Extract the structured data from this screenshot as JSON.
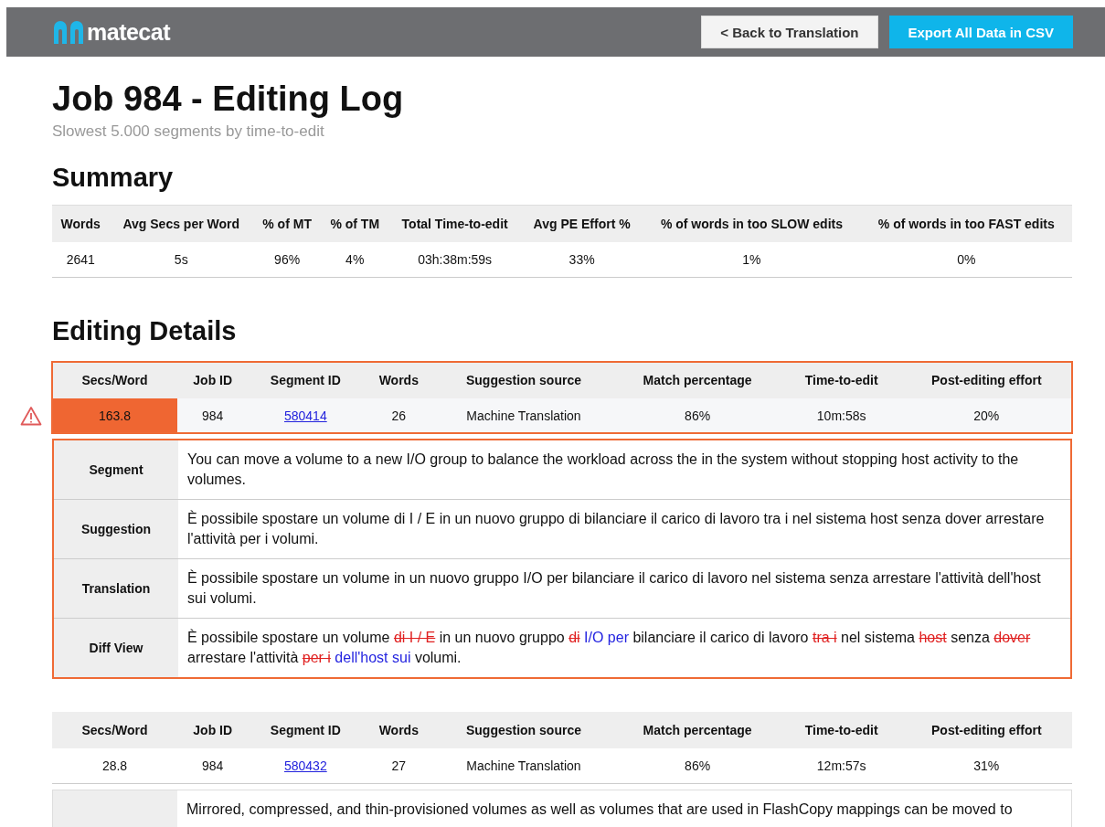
{
  "header": {
    "logo": "matecat",
    "buttons": [
      {
        "label": "< Back to Translation",
        "kind": "secondary"
      },
      {
        "label": "Export All Data in CSV",
        "kind": "primary"
      }
    ]
  },
  "title": "Job 984 - Editing Log",
  "subtitle": "Slowest 5.000 segments by time-to-edit",
  "summary": {
    "heading": "Summary",
    "columns": [
      "Words",
      "Avg Secs per Word",
      "% of MT",
      "% of TM",
      "Total Time-to-edit",
      "Avg PE Effort %",
      "% of words in too SLOW edits",
      "% of words in too FAST edits"
    ],
    "row": [
      "2641",
      "5s",
      "96%",
      "4%",
      "03h:38m:59s",
      "33%",
      "1%",
      "0%"
    ]
  },
  "details": {
    "heading": "Editing Details",
    "entries": [
      {
        "flagged": true,
        "columns": [
          "Secs/Word",
          "Job ID",
          "Segment ID",
          "Words",
          "Suggestion source",
          "Match percentage",
          "Time-to-edit",
          "Post-editing effort"
        ],
        "row": [
          "163.8",
          "984",
          "580414",
          "26",
          "Machine Translation",
          "86%",
          "10m:58s",
          "20%"
        ],
        "sections": [
          {
            "label": "Segment",
            "kind": "text",
            "text": "You can move a volume to a new I/O group to balance the workload across the in the system without stopping host activity to the volumes."
          },
          {
            "label": "Suggestion",
            "kind": "text",
            "text": "È possibile spostare un volume di I / E in un nuovo gruppo di bilanciare il carico di lavoro tra i nel sistema host senza dover arrestare l'attività per i volumi."
          },
          {
            "label": "Translation",
            "kind": "text",
            "text": "È possibile spostare un volume in un nuovo gruppo I/O per bilanciare il carico di lavoro nel sistema senza arrestare l'attività dell'host sui volumi."
          },
          {
            "label": "Diff View",
            "kind": "diff",
            "parts": [
              {
                "kind": "same",
                "text": "È possibile spostare un volume "
              },
              {
                "kind": "del",
                "text": "di I / E"
              },
              {
                "kind": "same",
                "text": " in un nuovo gruppo "
              },
              {
                "kind": "del",
                "text": "di"
              },
              {
                "kind": "ins",
                "text": " I/O per"
              },
              {
                "kind": "same",
                "text": " bilanciare il carico di lavoro "
              },
              {
                "kind": "del",
                "text": "tra i"
              },
              {
                "kind": "same",
                "text": " nel sistema "
              },
              {
                "kind": "del",
                "text": "host"
              },
              {
                "kind": "same",
                "text": " senza "
              },
              {
                "kind": "del",
                "text": "dover"
              },
              {
                "kind": "same",
                "text": " arrestare l'attività "
              },
              {
                "kind": "del",
                "text": "per i"
              },
              {
                "kind": "ins",
                "text": " dell'host sui"
              },
              {
                "kind": "same",
                "text": " volumi."
              }
            ]
          }
        ]
      },
      {
        "flagged": false,
        "columns": [
          "Secs/Word",
          "Job ID",
          "Segment ID",
          "Words",
          "Suggestion source",
          "Match percentage",
          "Time-to-edit",
          "Post-editing effort"
        ],
        "row": [
          "28.8",
          "984",
          "580432",
          "27",
          "Machine Translation",
          "86%",
          "12m:57s",
          "31%"
        ],
        "sections": [
          {
            "kind": "text",
            "text": "Mirrored, compressed, and thin-provisioned volumes as well as volumes that are used in FlashCopy mappings can be moved to"
          }
        ]
      }
    ]
  }
}
